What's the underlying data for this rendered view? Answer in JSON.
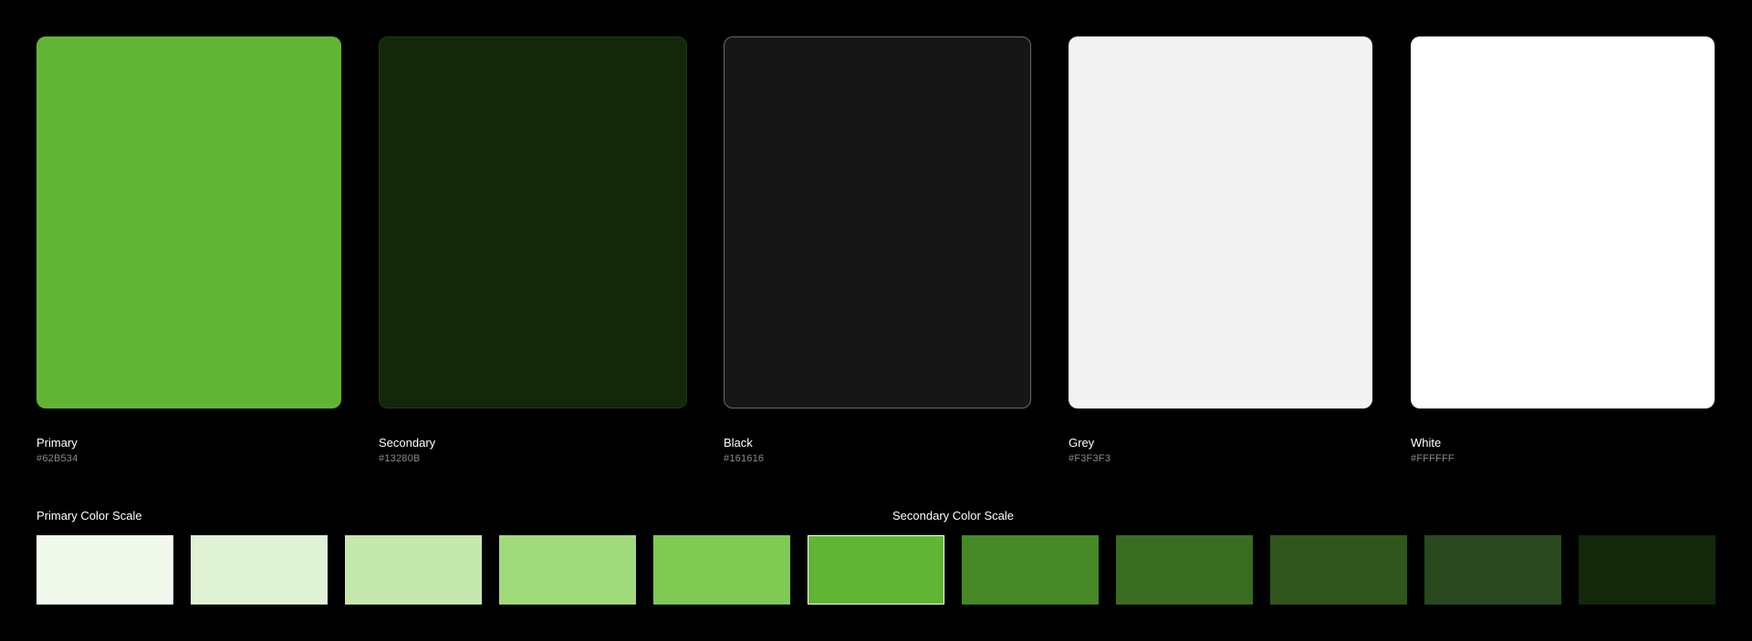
{
  "swatches": [
    {
      "name": "Primary",
      "hex": "#62B534",
      "color": "#62B534",
      "border": ""
    },
    {
      "name": "Secondary",
      "hex": "#13280B",
      "color": "#13280B",
      "border": "#1f3a14"
    },
    {
      "name": "Black",
      "hex": "#161616",
      "color": "#161616",
      "border": "#6a6a6a"
    },
    {
      "name": "Grey",
      "hex": "#F3F3F3",
      "color": "#F3F3F3",
      "border": ""
    },
    {
      "name": "White",
      "hex": "#FFFFFF",
      "color": "#FFFFFF",
      "border": ""
    }
  ],
  "primary_scale_title": "Primary Color Scale",
  "secondary_scale_title": "Secondary Color Scale",
  "scale": [
    {
      "color": "#F1F8EC",
      "selected": false
    },
    {
      "color": "#E0F2D6",
      "selected": false
    },
    {
      "color": "#C4E8AE",
      "selected": false
    },
    {
      "color": "#A1DA7B",
      "selected": false
    },
    {
      "color": "#7FCA52",
      "selected": false
    },
    {
      "color": "#62B534",
      "selected": true
    },
    {
      "color": "#468926",
      "selected": false
    },
    {
      "color": "#396C20",
      "selected": false
    },
    {
      "color": "#30561E",
      "selected": false
    },
    {
      "color": "#29481E",
      "selected": false
    },
    {
      "color": "#13280B",
      "selected": false
    }
  ]
}
